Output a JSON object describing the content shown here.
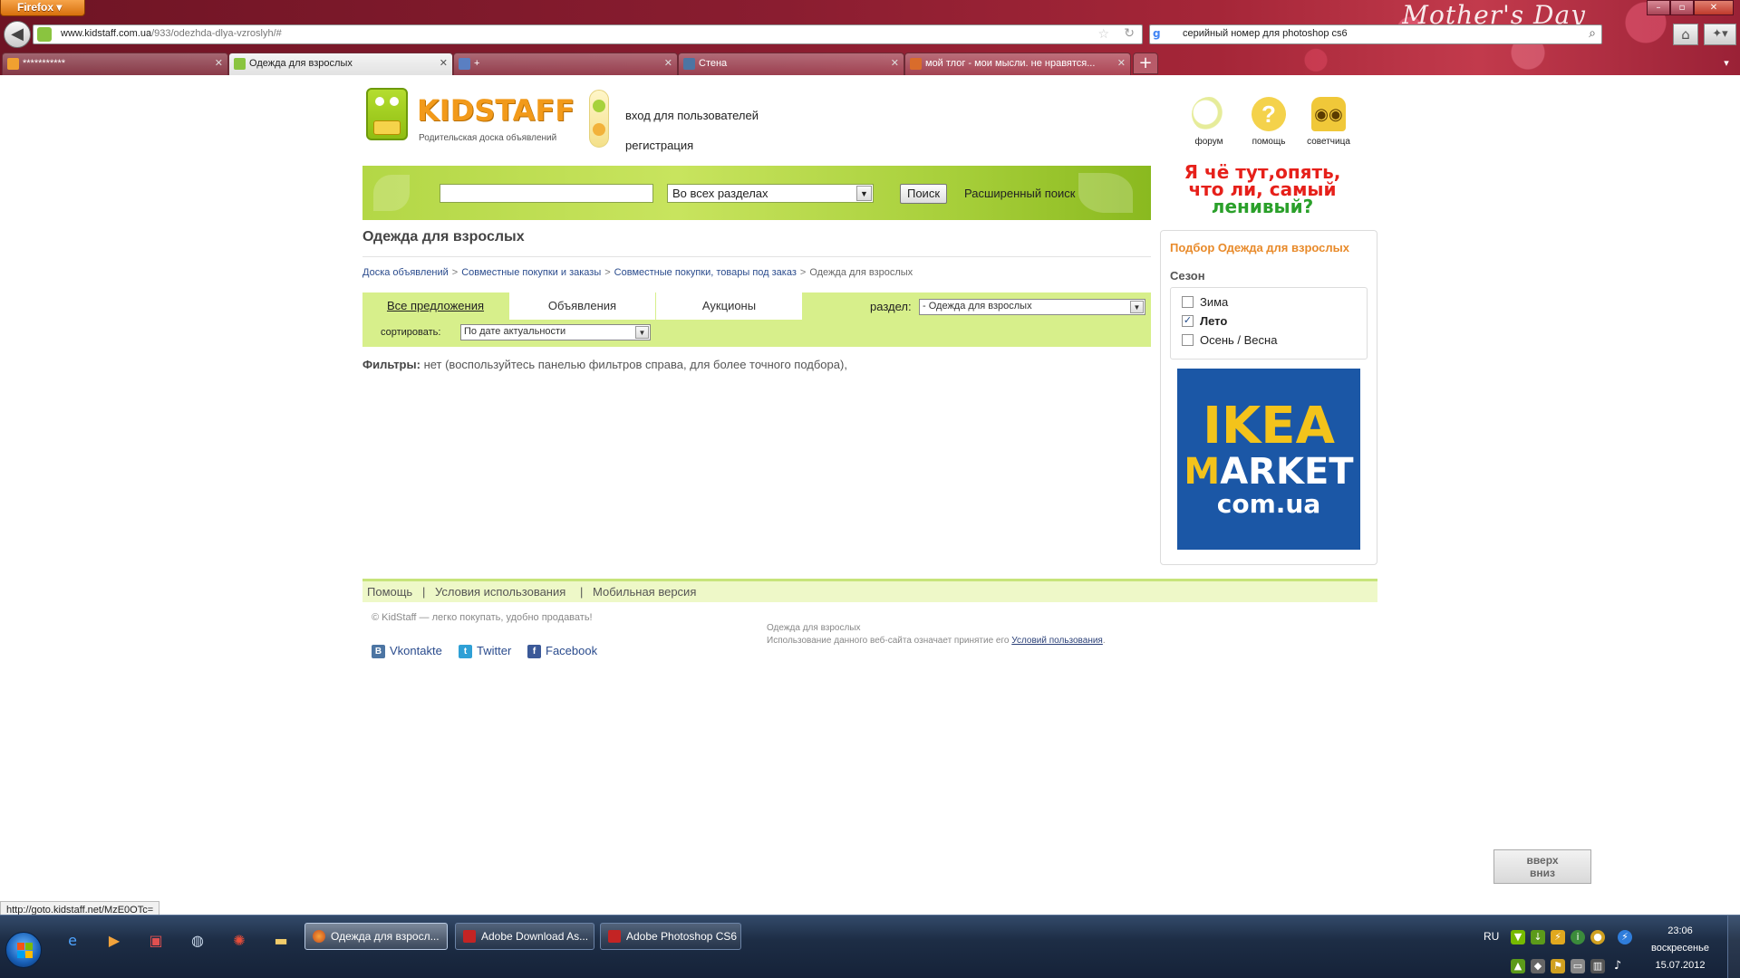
{
  "browser": {
    "menu_button": "Firefox",
    "branding": "Mother's Day",
    "url_domain": "www.kidstaff.com.ua",
    "url_path": "/933/odezhda-dlya-vzroslyh/#",
    "search_query": "серийный номер для photoshop cs6",
    "tabs": [
      {
        "label": "***********",
        "active": false
      },
      {
        "label": "Одежда для взрослых",
        "active": true
      },
      {
        "label": "",
        "active": false
      },
      {
        "label": "Стена",
        "active": false
      },
      {
        "label": "мой тлог - мои мысли. не нравятся...",
        "active": false
      }
    ],
    "status_url": "http://goto.kidstaff.net/MzE0OTc="
  },
  "site": {
    "logo_text": "KIDSTAFF",
    "logo_tagline": "Родительская доска объявлений",
    "auth": {
      "login": "вход для пользователей",
      "register": "регистрация"
    },
    "quick_links": {
      "forum": "форум",
      "help": "помощь",
      "advisor": "советчица"
    },
    "search": {
      "input_value": "",
      "section_value": "Во всех разделах",
      "button": "Поиск",
      "advanced": "Расширенный поиск"
    },
    "promo": {
      "line1": "Я чё тут,опять,",
      "line2": "что ли, самый",
      "line3": "ленивый?"
    },
    "page_title": "Одежда для взрослых",
    "breadcrumb": {
      "items": [
        "Доска объявлений",
        "Совместные покупки и заказы",
        "Совместные покупки, товары под заказ"
      ],
      "separator": ">",
      "current": "Одежда для взрослых"
    },
    "tabs": {
      "all": "Все предложения",
      "ads": "Объявления",
      "auctions": "Аукционы",
      "section_label": "раздел:",
      "section_value": "- Одежда для взрослых",
      "sort_label": "сортировать:",
      "sort_value": "По дате актуальности"
    },
    "filters": {
      "label": "Фильтры:",
      "text": "нет (воспользуйтесь панелью фильтров справа, для более точного подбора),"
    },
    "side_filter": {
      "title": "Подбор Одежда для взрослых",
      "season_label": "Сезон",
      "options": [
        {
          "label": "Зима",
          "checked": false
        },
        {
          "label": "Лето",
          "checked": true
        },
        {
          "label": "Осень / Весна",
          "checked": false
        }
      ]
    },
    "ad": {
      "line1": "IKEA",
      "line2_accent": "M",
      "line2": "ARKET",
      "line3": "com.ua"
    },
    "footer": {
      "links": [
        "Помощь",
        "Условия использования",
        "Мобильная версия"
      ],
      "separator": "|",
      "copyright": "© KidStaff — легко покупать, удобно продавать!",
      "category": "Одежда для взрослых",
      "note_prefix": "Использование данного веб-сайта означает принятие его",
      "note_link": "Условий пользования",
      "note_suffix": ".",
      "social": [
        "Vkontakte",
        "Twitter",
        "Facebook"
      ]
    },
    "updown": {
      "up": "вверх",
      "down": "вниз"
    }
  },
  "taskbar": {
    "tasks": [
      {
        "label": "Одежда для взросл...",
        "active": true
      },
      {
        "label": "Adobe Download As...",
        "active": false
      },
      {
        "label": "Adobe Photoshop CS6",
        "active": false
      }
    ],
    "language": "RU",
    "time": "23:06",
    "day": "воскресенье",
    "date": "15.07.2012"
  },
  "colors": {
    "accent_green": "#c8e45e",
    "tab_band": "#d7ef8b",
    "filter_title": "#e88a2a",
    "link_blue": "#2a4b8d",
    "ikea_blue": "#1b57a6",
    "ikea_yellow": "#f3c31b"
  }
}
